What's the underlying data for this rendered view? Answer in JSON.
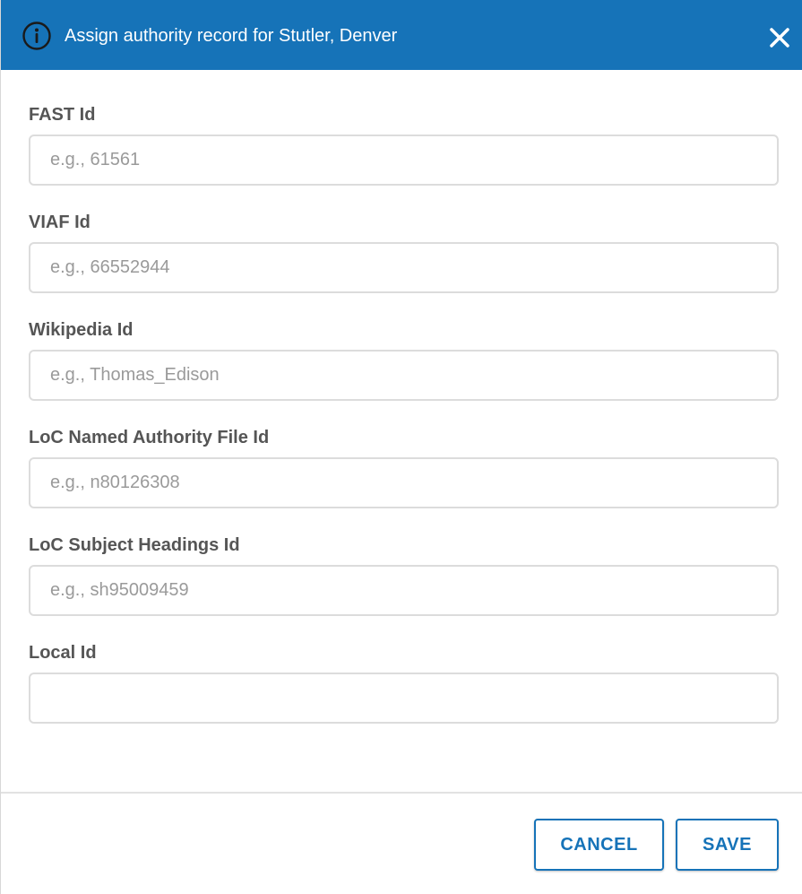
{
  "dialog": {
    "title": "Assign authority record for Stutler, Denver",
    "header_color": "#1673b8",
    "icons": {
      "info": "info-circle-icon",
      "close": "close-x-icon"
    }
  },
  "fields": [
    {
      "label": "FAST Id",
      "placeholder": "e.g., 61561",
      "value": ""
    },
    {
      "label": "VIAF Id",
      "placeholder": "e.g., 66552944",
      "value": ""
    },
    {
      "label": "Wikipedia Id",
      "placeholder": "e.g., Thomas_Edison",
      "value": ""
    },
    {
      "label": "LoC Named Authority File Id",
      "placeholder": "e.g., n80126308",
      "value": ""
    },
    {
      "label": "LoC Subject Headings Id",
      "placeholder": "e.g., sh95009459",
      "value": ""
    },
    {
      "label": "Local Id",
      "placeholder": "",
      "value": ""
    }
  ],
  "footer": {
    "cancel_label": "CANCEL",
    "save_label": "SAVE"
  }
}
